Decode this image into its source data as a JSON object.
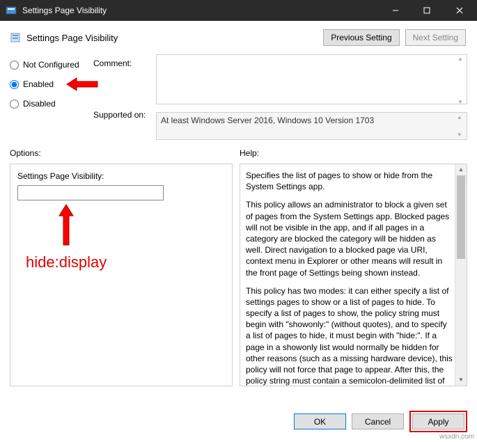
{
  "window": {
    "title": "Settings Page Visibility"
  },
  "header": {
    "title": "Settings Page Visibility",
    "prev_label": "Previous Setting",
    "next_label": "Next Setting"
  },
  "radios": {
    "not_configured": "Not Configured",
    "enabled": "Enabled",
    "disabled": "Disabled",
    "selected": "enabled"
  },
  "labels": {
    "comment": "Comment:",
    "supported": "Supported on:",
    "options": "Options:",
    "help": "Help:"
  },
  "supported_text": "At least Windows Server 2016, Windows 10 Version 1703",
  "options_panel": {
    "field_label": "Settings Page Visibility:",
    "field_value": ""
  },
  "annotation": {
    "text": "hide:display"
  },
  "help_text": {
    "p1": "Specifies the list of pages to show or hide from the System Settings app.",
    "p2": "This policy allows an administrator to block a given set of pages from the System Settings app. Blocked pages will not be visible in the app, and if all pages in a category are blocked the category will be hidden as well. Direct navigation to a blocked page via URI, context menu in Explorer or other means will result in the front page of Settings being shown instead.",
    "p3": "This policy has two modes: it can either specify a list of settings pages to show or a list of pages to hide. To specify a list of pages to show, the policy string must begin with \"showonly:\" (without quotes), and to specify a list of pages to hide, it must begin with \"hide:\". If a page in a showonly list would normally be hidden for other reasons (such as a missing hardware device), this policy will not force that page to appear. After this, the policy string must contain a semicolon-delimited list of settings page identifiers. The identifier for any given settings page is the published URI for that page, minus the \"ms-settings:\" protocol part."
  },
  "buttons": {
    "ok": "OK",
    "cancel": "Cancel",
    "apply": "Apply"
  },
  "watermark": "wsxdn.com"
}
